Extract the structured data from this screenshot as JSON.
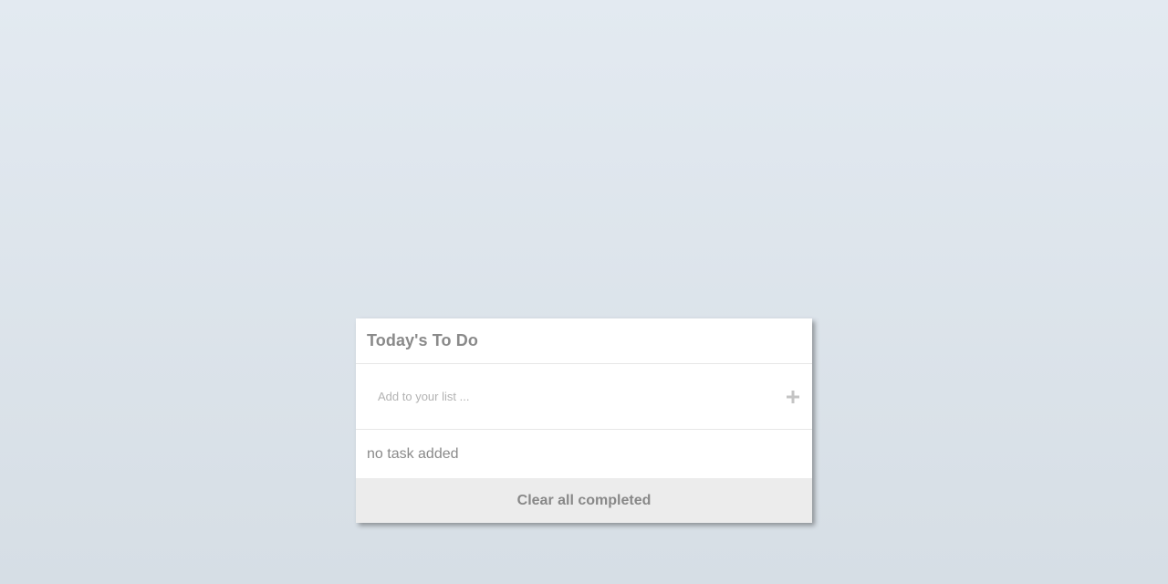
{
  "todo": {
    "title": "Today's To Do",
    "input": {
      "value": "",
      "placeholder": "Add to your list ..."
    },
    "add_icon": "plus-icon",
    "empty_message": "no task added",
    "clear_label": "Clear all completed"
  },
  "colors": {
    "text_muted": "#8a8a8a",
    "placeholder": "#b3b3b3",
    "footer_bg": "#ececec",
    "icon": "#c4c4c4"
  }
}
